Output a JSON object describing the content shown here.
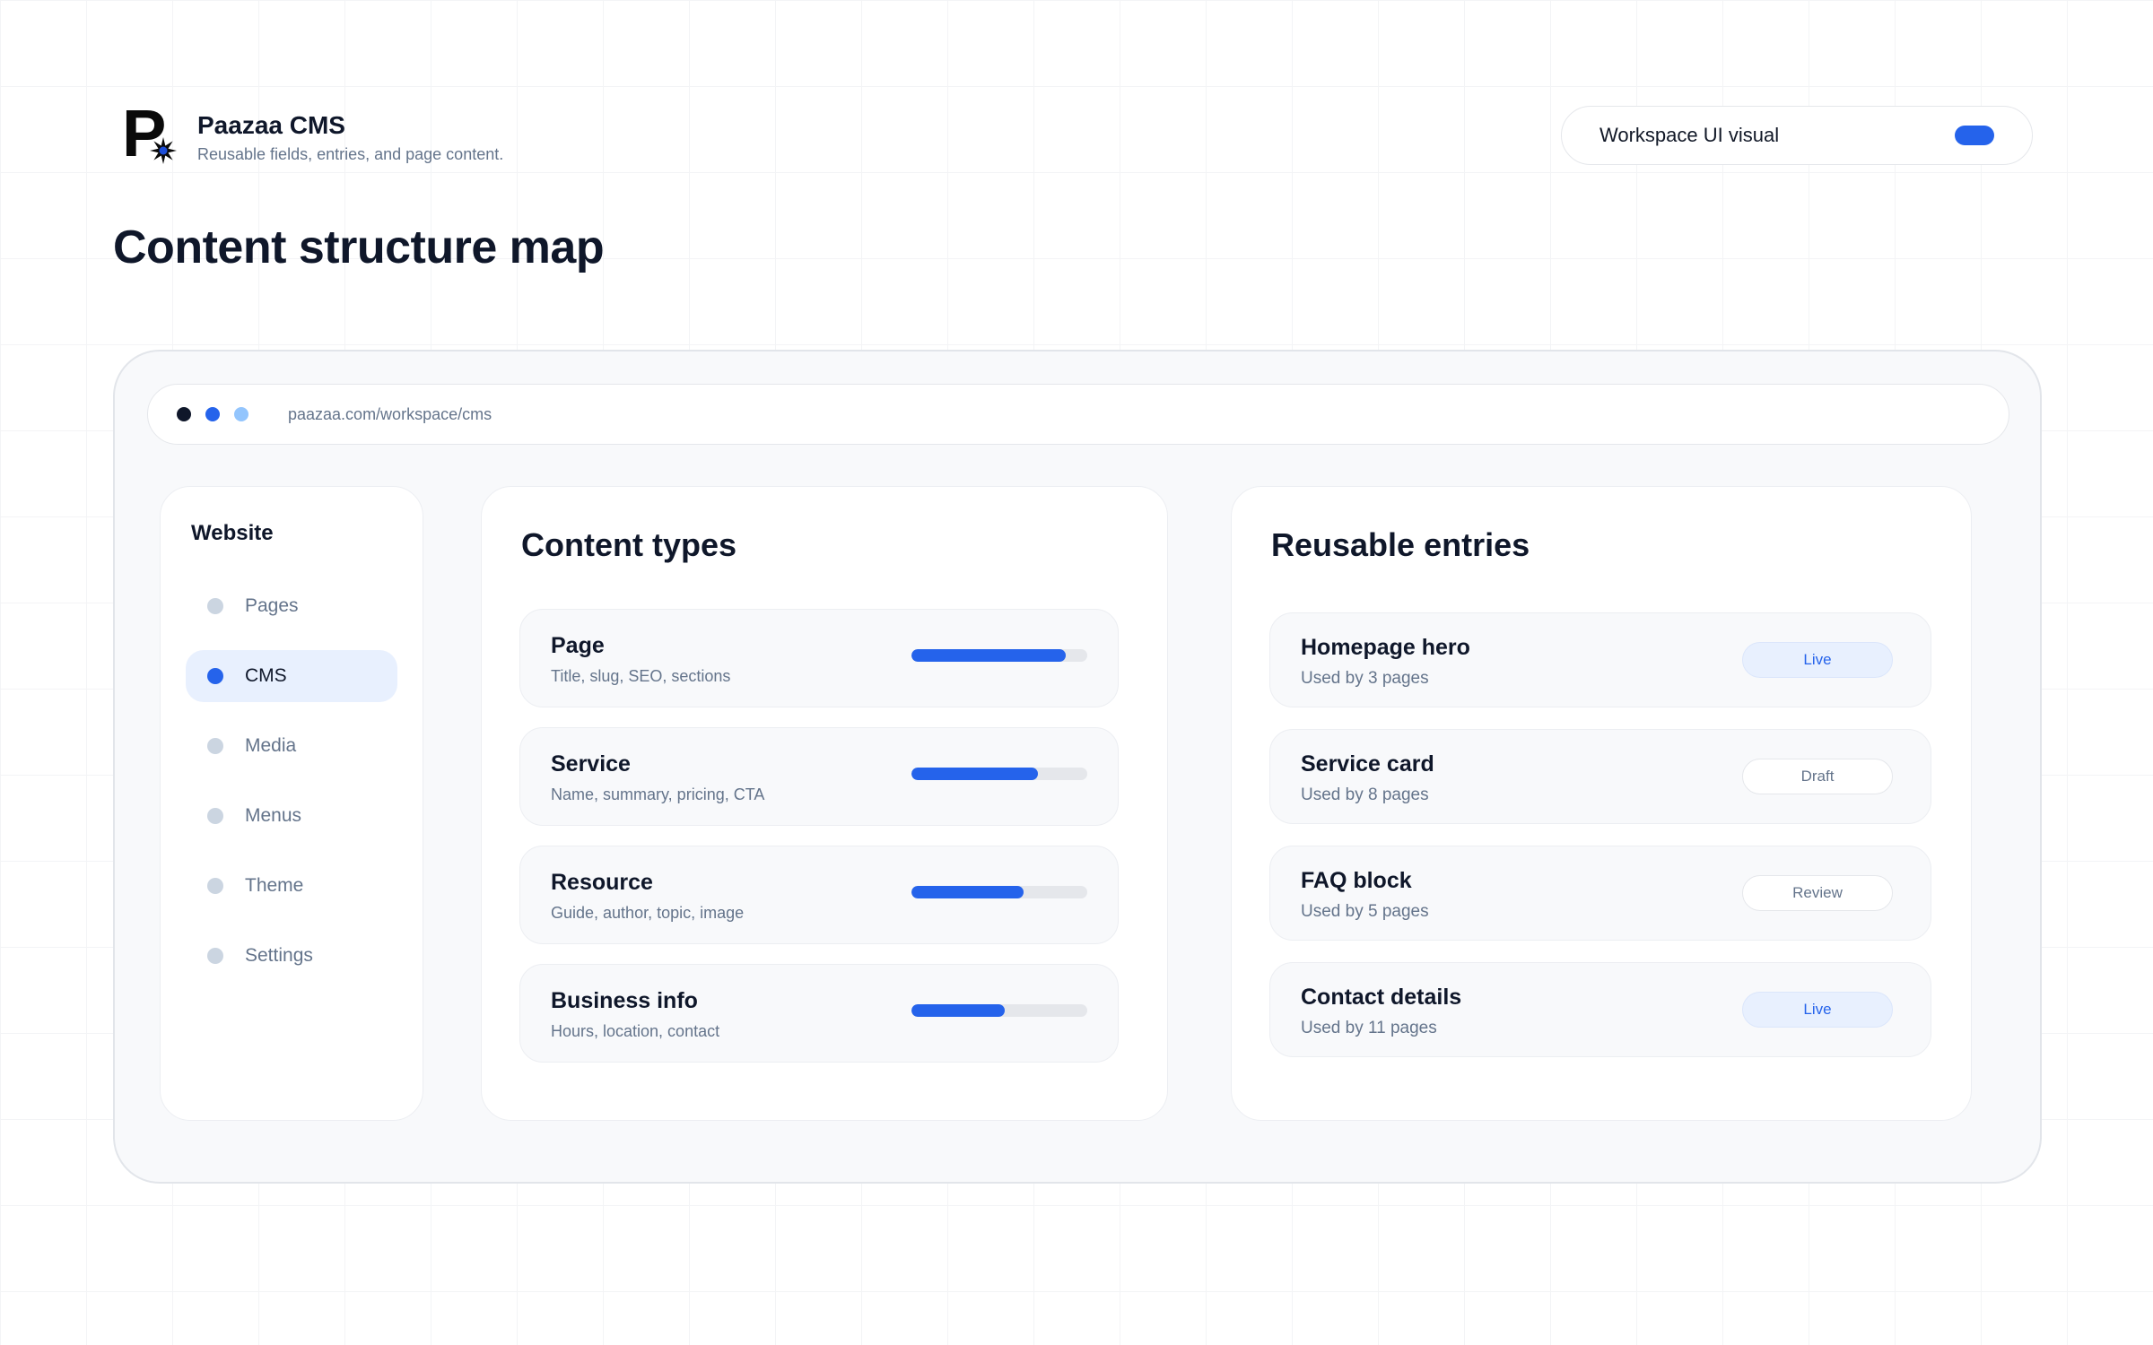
{
  "brand": {
    "logo_letter": "P",
    "name": "Paazaa CMS",
    "tagline": "Reusable fields, entries, and page content."
  },
  "toggle": {
    "label": "Workspace UI visual",
    "on": true
  },
  "page_title": "Content structure map",
  "browser": {
    "url": "paazaa.com/workspace/cms",
    "dots": [
      "#0f172a",
      "#2563eb",
      "#93c5fd"
    ]
  },
  "sidebar": {
    "title": "Website",
    "items": [
      {
        "label": "Pages",
        "active": false
      },
      {
        "label": "CMS",
        "active": true
      },
      {
        "label": "Media",
        "active": false
      },
      {
        "label": "Menus",
        "active": false
      },
      {
        "label": "Theme",
        "active": false
      },
      {
        "label": "Settings",
        "active": false
      }
    ]
  },
  "content_types": {
    "title": "Content types",
    "items": [
      {
        "name": "Page",
        "fields": "Title, slug, SEO, sections",
        "progress": 0.88
      },
      {
        "name": "Service",
        "fields": "Name, summary, pricing, CTA",
        "progress": 0.72
      },
      {
        "name": "Resource",
        "fields": "Guide, author, topic, image",
        "progress": 0.64
      },
      {
        "name": "Business info",
        "fields": "Hours, location, contact",
        "progress": 0.53
      }
    ]
  },
  "entries": {
    "title": "Reusable entries",
    "items": [
      {
        "name": "Homepage hero",
        "usage": "Used by 3 pages",
        "status": "Live"
      },
      {
        "name": "Service card",
        "usage": "Used by 8 pages",
        "status": "Draft"
      },
      {
        "name": "FAQ block",
        "usage": "Used by 5 pages",
        "status": "Review"
      },
      {
        "name": "Contact details",
        "usage": "Used by 11 pages",
        "status": "Live"
      }
    ]
  },
  "colors": {
    "accent": "#2563eb",
    "text": "#0f172a",
    "muted": "#64748b"
  }
}
